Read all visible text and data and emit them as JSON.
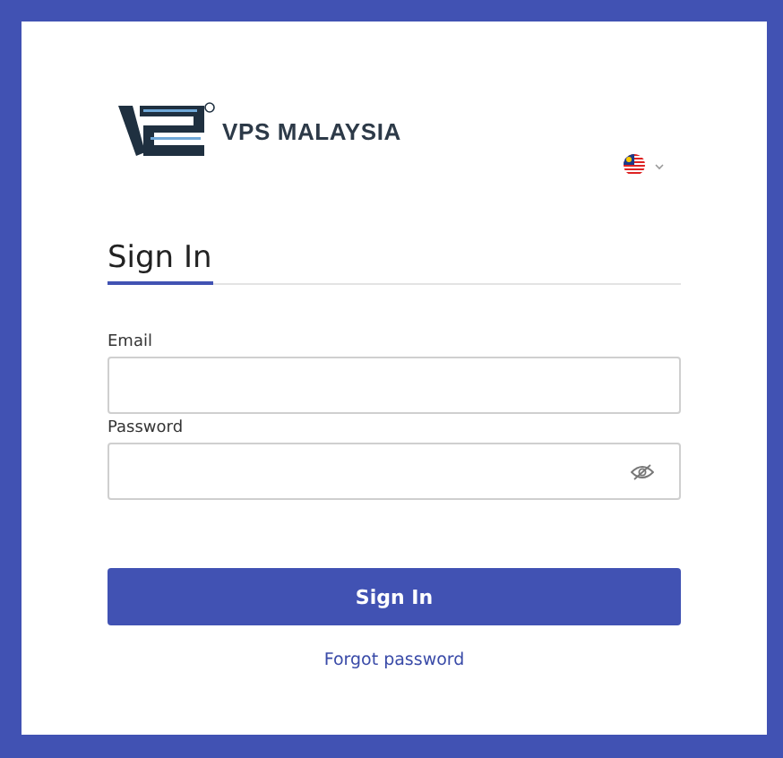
{
  "brand": {
    "name": "VPS MALAYSIA"
  },
  "tabs": [
    {
      "label": "Sign In",
      "selected": true
    }
  ],
  "fields": [
    {
      "label": "Email",
      "kind": "text"
    },
    {
      "label": "Password",
      "kind": "password"
    }
  ],
  "submit": "Sign In",
  "forgot_link": "Forgot password"
}
